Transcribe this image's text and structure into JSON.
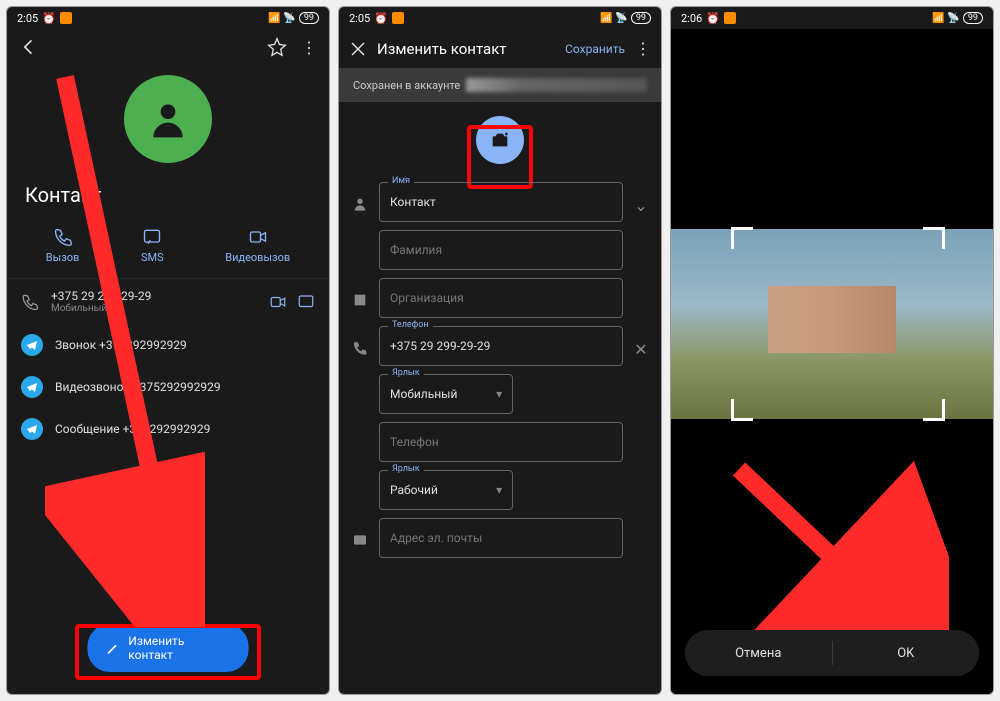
{
  "status": {
    "time1": "2:05",
    "time2": "2:05",
    "time3": "2:06",
    "battery": "99"
  },
  "s1": {
    "contact_name": "Контакт",
    "actions": {
      "call": "Вызов",
      "sms": "SMS",
      "video": "Видеовызов"
    },
    "phone": {
      "number": "+375 29 299-29-29",
      "label": "Мобильный"
    },
    "tg_call": "Звонок +375292992929",
    "tg_video": "Видеозвонок +375292992929",
    "tg_msg": "Сообщение +375292992929",
    "edit_label": "Изменить контакт"
  },
  "s2": {
    "title": "Изменить контакт",
    "save": "Сохранить",
    "saved_in": "Сохранен в аккаунте",
    "name_label": "Имя",
    "name_value": "Контакт",
    "surname_placeholder": "Фамилия",
    "org_placeholder": "Организация",
    "phone_label": "Телефон",
    "phone_value": "+375 29 299-29-29",
    "tag_label": "Ярлык",
    "tag_value": "Мобильный",
    "phone2_placeholder": "Телефон",
    "tag2_value": "Рабочий",
    "email_placeholder": "Адрес эл. почты"
  },
  "s3": {
    "cancel": "Отмена",
    "ok": "OK"
  }
}
